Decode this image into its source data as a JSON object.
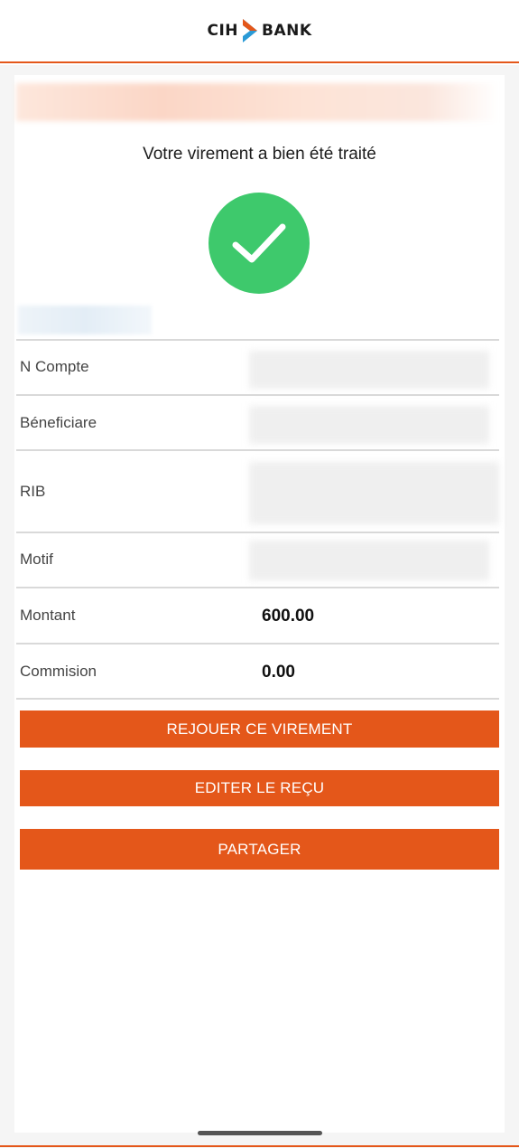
{
  "header": {
    "logo_left": "CIH",
    "logo_right": "BANK",
    "brand_color": "#e4571a"
  },
  "confirmation": {
    "title": "Votre virement a bien été traité",
    "status_icon": "check-icon",
    "status_color": "#3ec96c"
  },
  "details": {
    "account_label": "N Compte",
    "beneficiary_label": "Béneficiare",
    "rib_label": "RIB",
    "motif_label": "Motif",
    "amount_label": "Montant",
    "amount_value": "600.00",
    "commission_label": "Commision",
    "commission_value": "0.00"
  },
  "actions": {
    "replay": "REJOUER CE VIREMENT",
    "receipt": "EDITER LE REÇU",
    "share": "PARTAGER"
  }
}
